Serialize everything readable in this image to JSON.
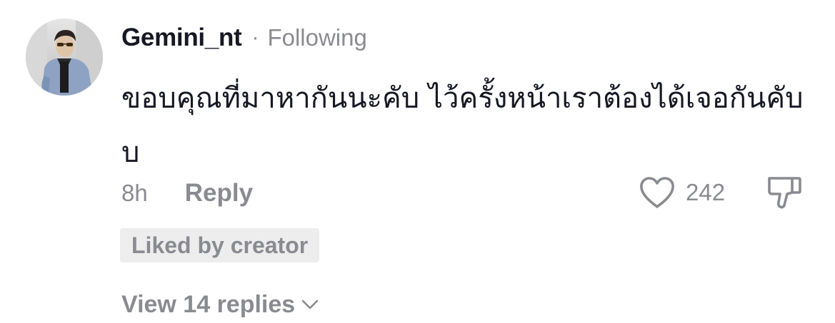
{
  "comment": {
    "username": "Gemini_nt",
    "separator": "·",
    "follow_status": "Following",
    "text": "ขอบคุณที่มาหากันนะคับ ไว้ครั้งหน้าเราต้องได้เจอกันคับบ",
    "time_ago": "8h",
    "reply_label": "Reply",
    "like_count": "242",
    "liked_by_creator_label": "Liked by creator",
    "view_replies_label": "View 14 replies"
  },
  "icons": {
    "like": "heart-outline-icon",
    "dislike": "thumbs-down-outline-icon",
    "expand": "chevron-down-icon"
  },
  "colors": {
    "primary_text": "#161823",
    "secondary_text": "#8a8b91",
    "badge_background": "#ededee"
  }
}
